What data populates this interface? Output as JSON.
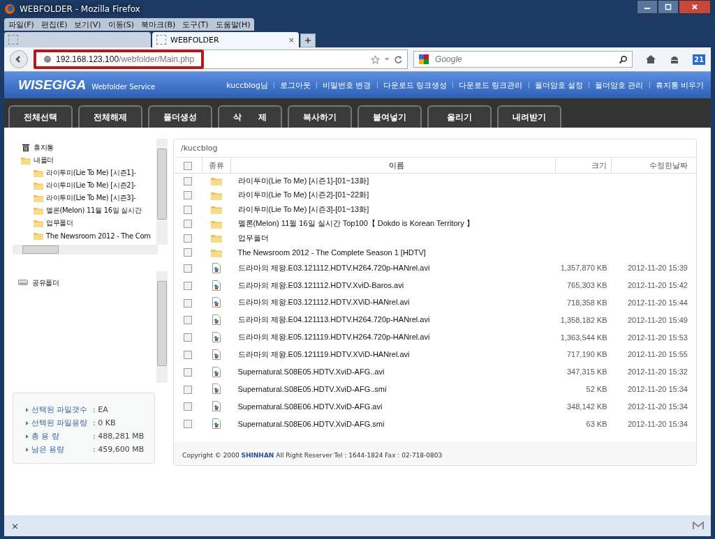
{
  "window": {
    "title": "WEBFOLDER - Mozilla Firefox"
  },
  "menu": [
    "파일(F)",
    "편집(E)",
    "보기(V)",
    "이동(S)",
    "북마크(B)",
    "도구(T)",
    "도움말(H)"
  ],
  "tabs": [
    {
      "selected": false
    },
    {
      "label": "WEBFOLDER",
      "selected": true,
      "close": "×"
    }
  ],
  "address": {
    "host": "192.168.123.100",
    "path": "/webfolder/Main.php"
  },
  "search": {
    "placeholder": "Google"
  },
  "calendar_badge": "21",
  "site": {
    "logo": "WISEGIGA",
    "subtitle": "Webfolder Service",
    "links": [
      "kuccblog님",
      "로그아웃",
      "비밀번호 변경",
      "다운로드 링크생성",
      "다운로드 링크관리",
      "폴더암호 설정",
      "폴더암호 관리",
      "휴지통 비우기"
    ]
  },
  "toolbar": [
    "전체선택",
    "전체해제",
    "폴더생성",
    "삭　　제",
    "복사하기",
    "붙여넣기",
    "올리기",
    "내려받기"
  ],
  "tree": [
    {
      "label": "휴지통",
      "kind": "trash"
    },
    {
      "label": "내폴더",
      "kind": "folder",
      "children": [
        {
          "label": "라이투미(Lie To Me) [시즌1]-",
          "kind": "folder"
        },
        {
          "label": "라이투미(Lie To Me) [시즌2]-",
          "kind": "folder"
        },
        {
          "label": "라이투미(Lie To Me) [시즌3]-",
          "kind": "folder"
        },
        {
          "label": "멜론(Melon) 11월 16일 실시간",
          "kind": "folder"
        },
        {
          "label": "업무폴더",
          "kind": "folder"
        },
        {
          "label": "The Newsroom 2012 - The Com",
          "kind": "folder"
        }
      ]
    }
  ],
  "shared": {
    "label": "공유폴더"
  },
  "info": [
    {
      "label": "선택된 파일갯수",
      "value": ": EA"
    },
    {
      "label": "선택된 파일용량",
      "value": ": 0 KB"
    },
    {
      "label": "총 용 량",
      "value": ": 488,281 MB"
    },
    {
      "label": "남은 용량",
      "value": ": 459,600 MB"
    }
  ],
  "path": "/kuccblog",
  "table": {
    "select_all": {
      "checked": false
    },
    "columns": [
      "종류",
      "이름",
      "크기",
      "수정한날짜"
    ],
    "rows": [
      {
        "kind": "folder",
        "checked": false,
        "name": "라이투미(Lie To Me) [시즌1]-[01~13화]"
      },
      {
        "kind": "folder",
        "checked": false,
        "name": "라이투미(Lie To Me) [시즌2]-[01~22화]"
      },
      {
        "kind": "folder",
        "checked": false,
        "name": "라이투미(Lie To Me) [시즌3]-[01~13화]"
      },
      {
        "kind": "folder",
        "checked": false,
        "name": "멜론(Melon) 11월 16일 실시간 Top100【 Dokdo is Korean Territory 】"
      },
      {
        "kind": "folder",
        "checked": false,
        "name": "업무폴더"
      },
      {
        "kind": "folder",
        "checked": false,
        "name": "The Newsroom 2012 - The Complete Season 1 [HDTV]"
      },
      {
        "kind": "file",
        "checked": false,
        "name": "드라마의 제왕.E03.121112.HDTV.H264.720p-HANrel.avi",
        "size": "1,357,870 KB",
        "date": "2012-11-20 15:39"
      },
      {
        "kind": "file",
        "checked": false,
        "name": "드라마의 제왕.E03.121112.HDTV.XviD-Baros.avi",
        "size": "765,303 KB",
        "date": "2012-11-20 15:42"
      },
      {
        "kind": "file",
        "checked": false,
        "name": "드라마의 제왕.E03.121112.HDTV.XViD-HANrel.avi",
        "size": "718,358 KB",
        "date": "2012-11-20 15:44"
      },
      {
        "kind": "file",
        "checked": false,
        "name": "드라마의 제왕.E04.121113.HDTV.H264.720p-HANrel.avi",
        "size": "1,358,182 KB",
        "date": "2012-11-20 15:49"
      },
      {
        "kind": "file",
        "checked": false,
        "name": "드라마의 제왕.E05.121119.HDTV.H264.720p-HANrel.avi",
        "size": "1,363,544 KB",
        "date": "2012-11-20 15:53"
      },
      {
        "kind": "file",
        "checked": false,
        "name": "드라마의 제왕.E05.121119.HDTV.XViD-HANrel.avi",
        "size": "717,190 KB",
        "date": "2012-11-20 15:55"
      },
      {
        "kind": "file",
        "checked": false,
        "name": "Supernatural.S08E05.HDTV.XviD-AFG..avi",
        "size": "347,315 KB",
        "date": "2012-11-20 15:32"
      },
      {
        "kind": "file",
        "checked": false,
        "name": "Supernatural.S08E05.HDTV.XviD-AFG..smi",
        "size": "52 KB",
        "date": "2012-11-20 15:34"
      },
      {
        "kind": "file",
        "checked": false,
        "name": "Supernatural.S08E06.HDTV.XviD-AFG.avi",
        "size": "348,142 KB",
        "date": "2012-11-20 15:34"
      },
      {
        "kind": "file",
        "checked": false,
        "name": "Supernatural.S08E06.HDTV.XviD-AFG.smi",
        "size": "63 KB",
        "date": "2012-11-20 15:34"
      }
    ]
  },
  "footer": "Copyright © 2000 **SHINHAN** All Right Reserver Tel : 1644-1824 Fax : 02-718-0803",
  "status_bar": {
    "close": "×"
  }
}
